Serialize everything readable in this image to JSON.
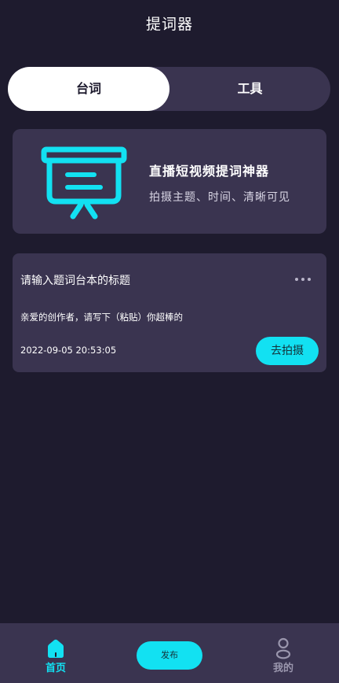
{
  "header": {
    "title": "提词器"
  },
  "tabs": [
    {
      "label": "台词",
      "active": true
    },
    {
      "label": "工具",
      "active": false
    }
  ],
  "hero": {
    "icon": "presentation-board-icon",
    "title": "直播短视频提词神器",
    "subtitle": "拍摄主题、时间、清晰可见"
  },
  "script_card": {
    "title": "请输入题词台本的标题",
    "body": "亲爱的创作者，请写下（粘贴）你超棒的",
    "date": "2022-09-05 20:53:05",
    "action_label": "去拍摄",
    "more_icon": "more-horizontal-icon"
  },
  "bottom_nav": {
    "home_label": "首页",
    "home_icon": "home-icon",
    "publish_label": "发布",
    "mine_label": "我的",
    "mine_icon": "user-icon"
  },
  "colors": {
    "background": "#1e1b2e",
    "card": "#3a3450",
    "accent": "#12e1f2",
    "inactive": "#9a96ad"
  }
}
